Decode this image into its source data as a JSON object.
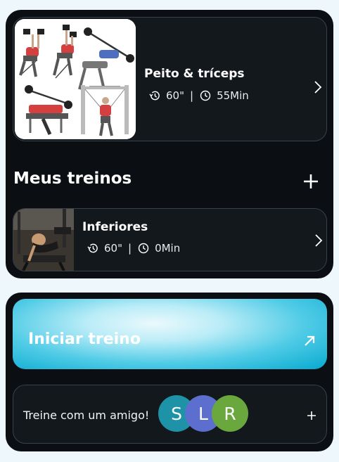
{
  "featured_workout": {
    "title": "Peito & tríceps",
    "rest": "60\"",
    "separator": "|",
    "duration": "55Min"
  },
  "my_workouts": {
    "title": "Meus treinos",
    "items": [
      {
        "title": "Inferiores",
        "rest": "60\"",
        "separator": "|",
        "duration": "0Min"
      }
    ]
  },
  "start_workout": {
    "label": "Iniciar treino"
  },
  "friend": {
    "label": "Treine com um amigo!",
    "avatars": [
      {
        "letter": "S",
        "color": "#1e93a8"
      },
      {
        "letter": "L",
        "color": "#5c6fcf"
      },
      {
        "letter": "R",
        "color": "#6aa83e"
      }
    ]
  },
  "icons": [
    "history-icon",
    "clock-icon",
    "chevron-right-icon",
    "plus-icon",
    "arrow-up-right-icon"
  ],
  "colors": {
    "background": "#eef7fc",
    "panel": "#0b0f14",
    "accent": "#07a9d0"
  }
}
